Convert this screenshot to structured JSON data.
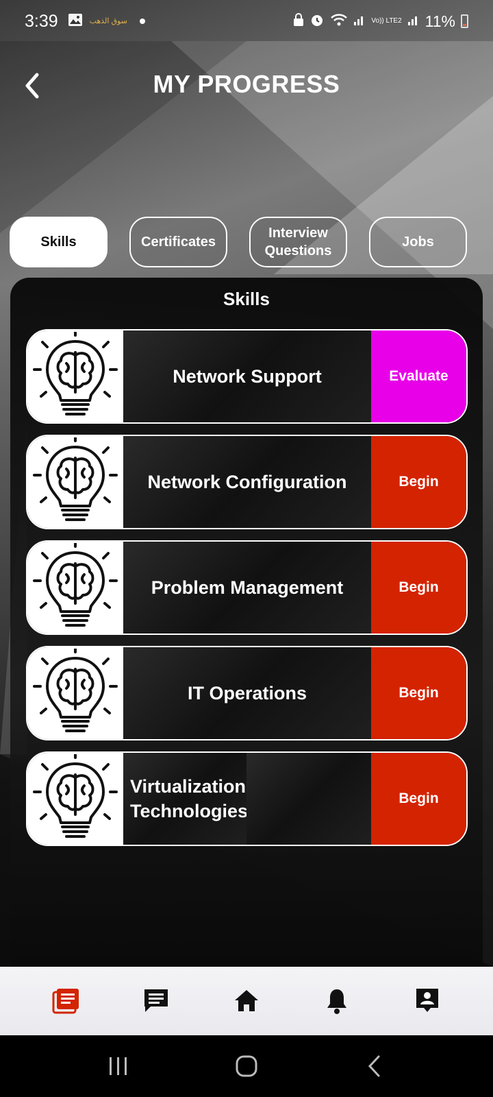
{
  "status_bar": {
    "time": "3:39",
    "arabic_app_label": "سوق الذهب",
    "network": "Vo)) LTE2",
    "battery": "11%"
  },
  "header": {
    "title": "MY PROGRESS",
    "back_icon": "chevron-left-icon"
  },
  "tabs": [
    {
      "label": "Skills",
      "active": true
    },
    {
      "label": "Certificates",
      "active": false
    },
    {
      "label": "Interview Questions",
      "active": false
    },
    {
      "label": "Jobs",
      "active": false
    }
  ],
  "panel": {
    "title": "Skills",
    "skills": [
      {
        "name": "Network Support",
        "action": "Evaluate",
        "action_color": "#E800E8"
      },
      {
        "name": "Network Configuration",
        "action": "Begin",
        "action_color": "#D42300"
      },
      {
        "name": "Problem Management",
        "action": "Begin",
        "action_color": "#D42300"
      },
      {
        "name": "IT Operations",
        "action": "Begin",
        "action_color": "#D42300"
      },
      {
        "name": "Virtualization Technologies",
        "action": "Begin",
        "action_color": "#D42300"
      }
    ],
    "skill_icon": "brain-lightbulb-icon"
  },
  "bottom_nav": {
    "items": [
      {
        "icon": "progress-list-icon",
        "active": true
      },
      {
        "icon": "chat-icon",
        "active": false
      },
      {
        "icon": "home-icon",
        "active": false
      },
      {
        "icon": "bell-icon",
        "active": false
      },
      {
        "icon": "profile-icon",
        "active": false
      }
    ],
    "active_color": "#D42300"
  }
}
